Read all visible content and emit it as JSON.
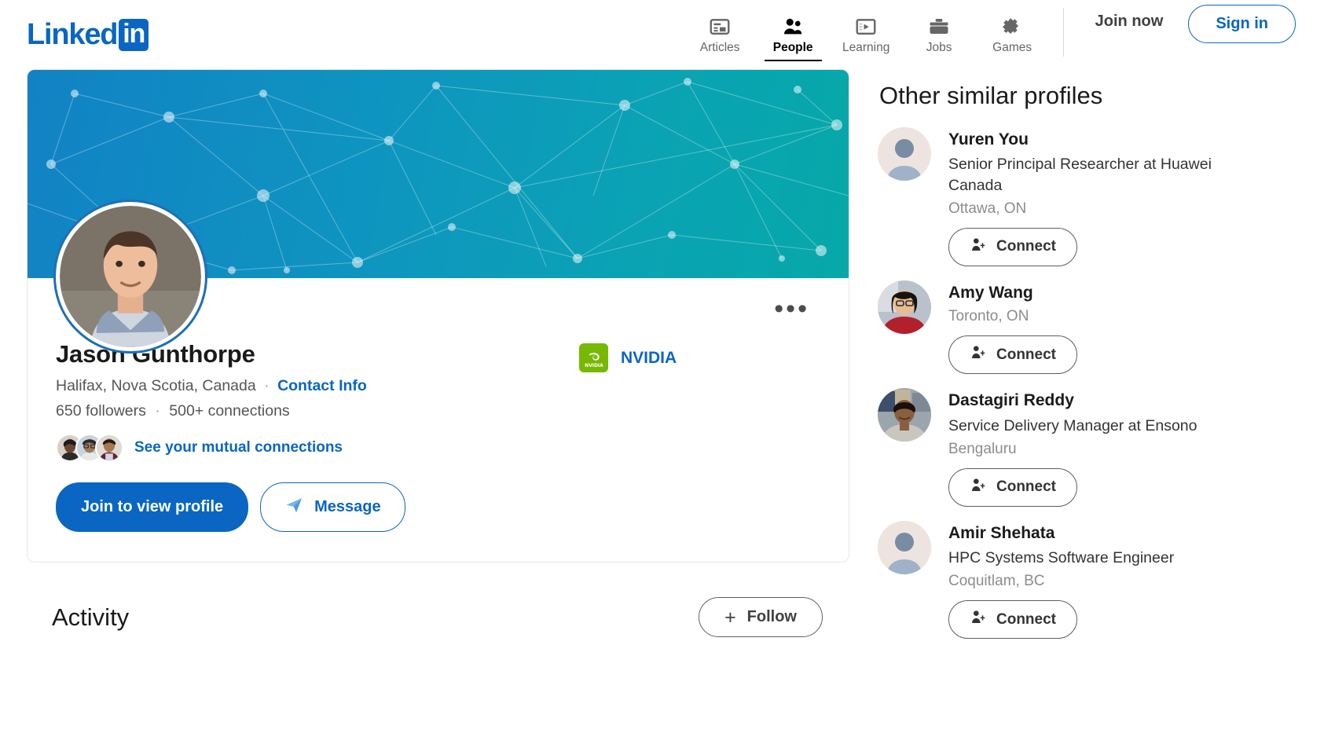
{
  "header": {
    "logo_text": "Linked",
    "logo_badge": "in",
    "nav": [
      {
        "label": "Articles",
        "icon": "articles-icon",
        "active": false
      },
      {
        "label": "People",
        "icon": "people-icon",
        "active": true
      },
      {
        "label": "Learning",
        "icon": "learning-icon",
        "active": false
      },
      {
        "label": "Jobs",
        "icon": "jobs-icon",
        "active": false
      },
      {
        "label": "Games",
        "icon": "games-icon",
        "active": false
      }
    ],
    "join_now": "Join now",
    "sign_in": "Sign in"
  },
  "profile": {
    "name": "Jason Gunthorpe",
    "location": "Halifax, Nova Scotia, Canada",
    "separator": "·",
    "contact_info": "Contact Info",
    "followers": "650 followers",
    "connections": "500+ connections",
    "mutual_link": "See your mutual connections",
    "join_button": "Join to view profile",
    "message_button": "Message",
    "company": "NVIDIA",
    "company_logo_text": "NVIDIA",
    "more_menu": "•••"
  },
  "activity": {
    "title": "Activity",
    "follow_button": "Follow",
    "follow_plus": "+"
  },
  "sidebar": {
    "title": "Other similar profiles",
    "connect_label": "Connect",
    "profiles": [
      {
        "name": "Yuren You",
        "headline": "Senior Principal Researcher at Huawei Canada",
        "location": "Ottawa, ON",
        "avatar": "placeholder-avatar",
        "connect": "Connect"
      },
      {
        "name": "Amy Wang",
        "headline": "",
        "location": "Toronto, ON",
        "avatar": "photo-avatar-woman",
        "connect": "Connect"
      },
      {
        "name": "Dastagiri Reddy",
        "headline": "Service Delivery Manager at Ensono",
        "location": "Bengaluru",
        "avatar": "photo-avatar-man",
        "connect": "Connect"
      },
      {
        "name": "Amir Shehata",
        "headline": "HPC Systems Software Engineer",
        "location": "Coquitlam, BC",
        "avatar": "placeholder-avatar",
        "connect": "Connect"
      }
    ]
  },
  "colors": {
    "brand_blue": "#0a66c2",
    "banner_start": "#1282c5",
    "banner_end": "#06a8a8",
    "nvidia_green": "#76b900",
    "text_dark": "#1a1a1a",
    "text_muted": "#8c8c8c"
  }
}
